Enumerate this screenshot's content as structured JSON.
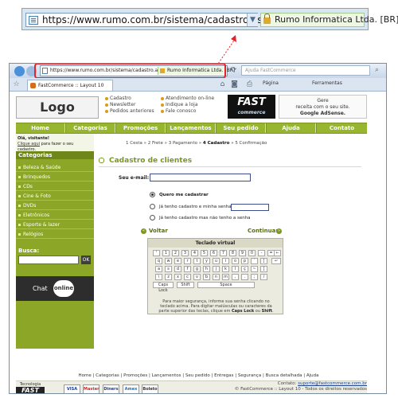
{
  "zoom": {
    "url": "https://www.rumo.com.br/sistema/cadastro.as",
    "security_label": "Rumo Informatica Ltda. [BR]"
  },
  "browser": {
    "address_url": "https://www.rumo.com.br/sistema/cadastro.as",
    "security_label": "Rumo Informatica Ltda. [BR]",
    "search_placeholder": "Ajuda FastCommerce",
    "tab_title": "FastCommerce :: Layout 10",
    "toolbar_page": "Página",
    "toolbar_tools": "Ferramentas"
  },
  "site": {
    "logo": "Logo",
    "header_links_col1": [
      "Cadastro",
      "Newsletter",
      "Pedidos anteriores"
    ],
    "header_links_col2": [
      "Atendimento on-line",
      "Indique a loja",
      "Fale conosco"
    ],
    "fast_logo": "FAST",
    "fast_sub": "commerce",
    "adsense_line1": "Gere",
    "adsense_line2": "receita com o seu site.",
    "adsense_line3": "Google AdSense.",
    "menu": [
      "Home",
      "Categorias",
      "Promoções",
      "Lançamentos",
      "Seu pedido",
      "Ajuda",
      "Contato"
    ],
    "welcome_line1": "Olá, visitante!",
    "welcome_link": "Clique aqui",
    "welcome_line2": " para fazer o seu cadastro.",
    "categories_title": "Categorias",
    "categories": [
      "Beleza & Saúde",
      "Brinquedos",
      "CDs",
      "Cine & Foto",
      "DVDs",
      "Eletrônicos",
      "Esporte & lazer",
      "Relógios"
    ],
    "busca_label": "Busca:",
    "busca_ok": "OK",
    "chat_label": "Chat",
    "chat_status": "online"
  },
  "main": {
    "steps": [
      "1 Cesta",
      "2 Frete",
      "3 Pagamento",
      "4 Cadastro",
      "5 Confirmação"
    ],
    "steps_sep": "»",
    "title": "Cadastro de clientes",
    "email_label": "Seu e-mail:",
    "opt_new": "Quero me cadastrar",
    "opt_registered": "Já tenho cadastro e minha senha é:",
    "opt_forgot": "Já tenho cadastro mas não tenho a senha",
    "back": "Voltar",
    "continue": "Continuar"
  },
  "keyboard": {
    "title": "Teclado virtual",
    "row1": [
      "'",
      "1",
      "2",
      "3",
      "4",
      "5",
      "6",
      "7",
      "8",
      "9",
      "0",
      "-",
      "="
    ],
    "row2": [
      "q",
      "w",
      "e",
      "r",
      "t",
      "y",
      "u",
      "i",
      "o",
      "p",
      "´",
      "["
    ],
    "row3": [
      "a",
      "s",
      "d",
      "f",
      "g",
      "h",
      "j",
      "k",
      "l",
      "ç",
      "~",
      "]"
    ],
    "row4": [
      "\\",
      "z",
      "x",
      "c",
      "v",
      "b",
      "n",
      "m",
      ",",
      ".",
      ";",
      "/"
    ],
    "backspace": "←",
    "enter": "↵",
    "caps": "Caps Lock",
    "shift": "Shift",
    "space": "Space",
    "note_line1": "Para maior segurança, informe sua senha clicando no",
    "note_line2": "teclado acima. Para digitar maiúsculas ou caracteres da",
    "note_line3a": "parte superior das teclas, clique em ",
    "note_caps": "Caps Lock",
    "note_ou": " ou ",
    "note_shift": "Shift",
    "note_end": "."
  },
  "footer": {
    "links": [
      "Home",
      "Categorias",
      "Promoções",
      "Lançamentos",
      "Seu pedido",
      "Entregas",
      "Segurança",
      "Busca detalhada",
      "Ajuda"
    ],
    "tecno_label": "Tecnologia",
    "tecno_logo": "FAST",
    "payments": [
      "VISA",
      "Master",
      "Diners",
      "Amex",
      "Boleto"
    ],
    "contact_label": "Contato: ",
    "contact_email": "suporte@fastcommerce.com.br",
    "copyright": "© FastCommerce :: Layout 10 - Todos os direitos reservados"
  }
}
